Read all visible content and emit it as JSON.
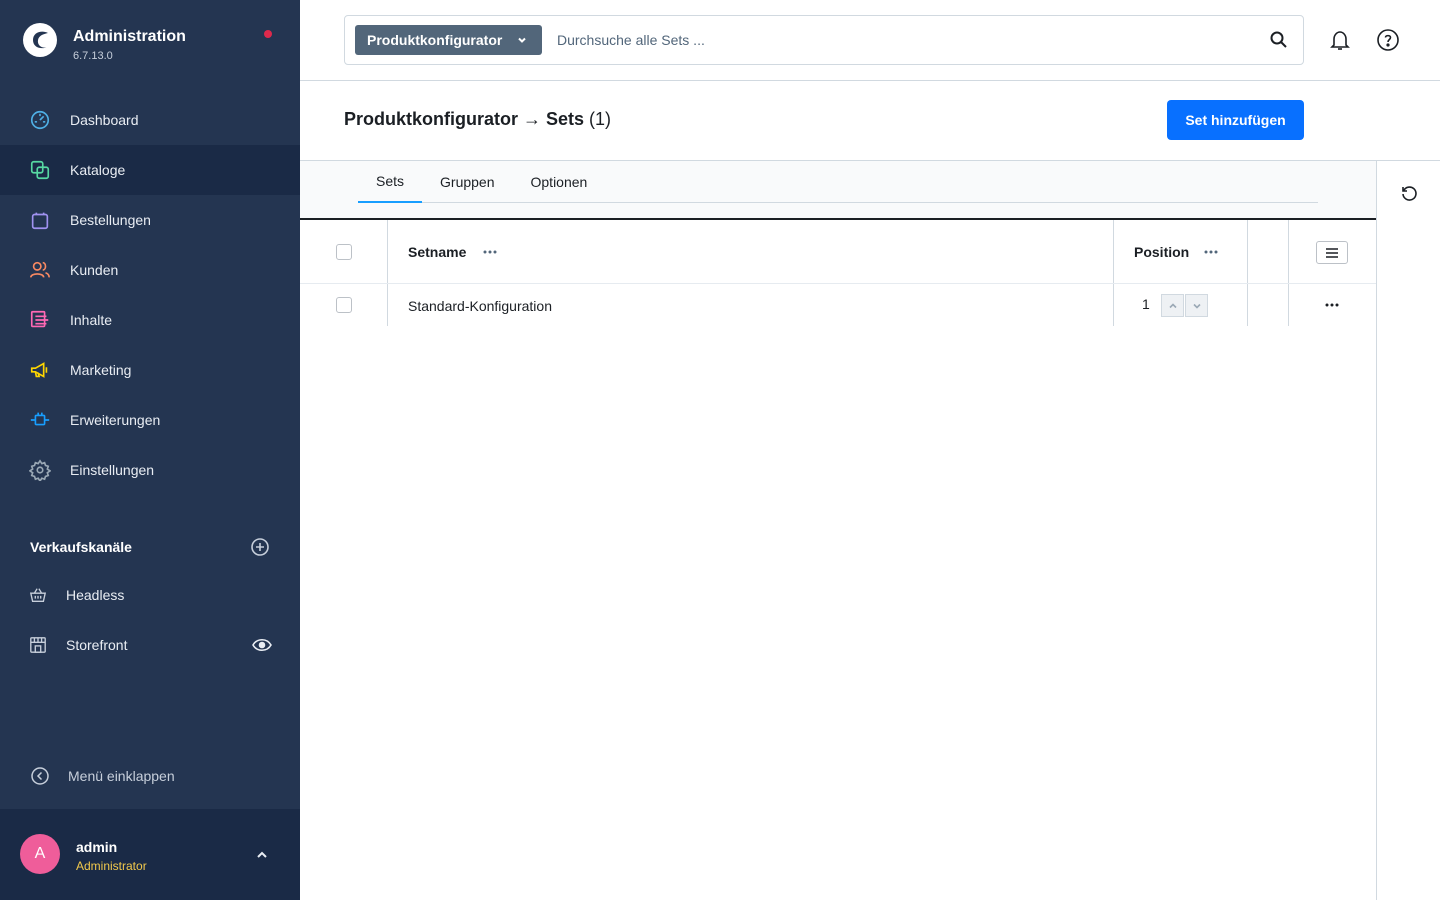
{
  "brand": {
    "title": "Administration",
    "version": "6.7.13.0"
  },
  "nav": {
    "items": [
      {
        "label": "Dashboard",
        "icon": "dashboard-icon",
        "color": "#4fb0e6"
      },
      {
        "label": "Kataloge",
        "icon": "catalog-icon",
        "color": "#57d9a3",
        "active": true
      },
      {
        "label": "Bestellungen",
        "icon": "orders-icon",
        "color": "#a092f0"
      },
      {
        "label": "Kunden",
        "icon": "customers-icon",
        "color": "#f88962"
      },
      {
        "label": "Inhalte",
        "icon": "content-icon",
        "color": "#ff68b4"
      },
      {
        "label": "Marketing",
        "icon": "marketing-icon",
        "color": "#ffd700"
      },
      {
        "label": "Erweiterungen",
        "icon": "extensions-icon",
        "color": "#189eff"
      },
      {
        "label": "Einstellungen",
        "icon": "settings-icon",
        "color": "#9aa8b5"
      }
    ]
  },
  "sales_channels": {
    "title": "Verkaufskanäle",
    "items": [
      {
        "label": "Headless",
        "icon": "basket-icon"
      },
      {
        "label": "Storefront",
        "icon": "storefront-icon"
      }
    ]
  },
  "collapse_label": "Menü einklappen",
  "user": {
    "initial": "A",
    "name": "admin",
    "role": "Administrator"
  },
  "search": {
    "type_label": "Produktkonfigurator",
    "placeholder": "Durchsuche alle Sets ..."
  },
  "page": {
    "title": "Produktkonfigurator → Sets",
    "count": "(1)",
    "add_button": "Set hinzufügen"
  },
  "tabs": [
    {
      "label": "Sets",
      "active": true
    },
    {
      "label": "Gruppen"
    },
    {
      "label": "Optionen"
    }
  ],
  "table": {
    "columns": {
      "name": "Setname",
      "position": "Position"
    },
    "rows": [
      {
        "name": "Standard-Konfiguration",
        "position": "1"
      }
    ]
  },
  "colors": {
    "sidebar": "#243551",
    "primary": "#0870ff",
    "active_tab": "#189eff",
    "avatar": "#ef5d9a",
    "notification_dot": "#de294c"
  }
}
